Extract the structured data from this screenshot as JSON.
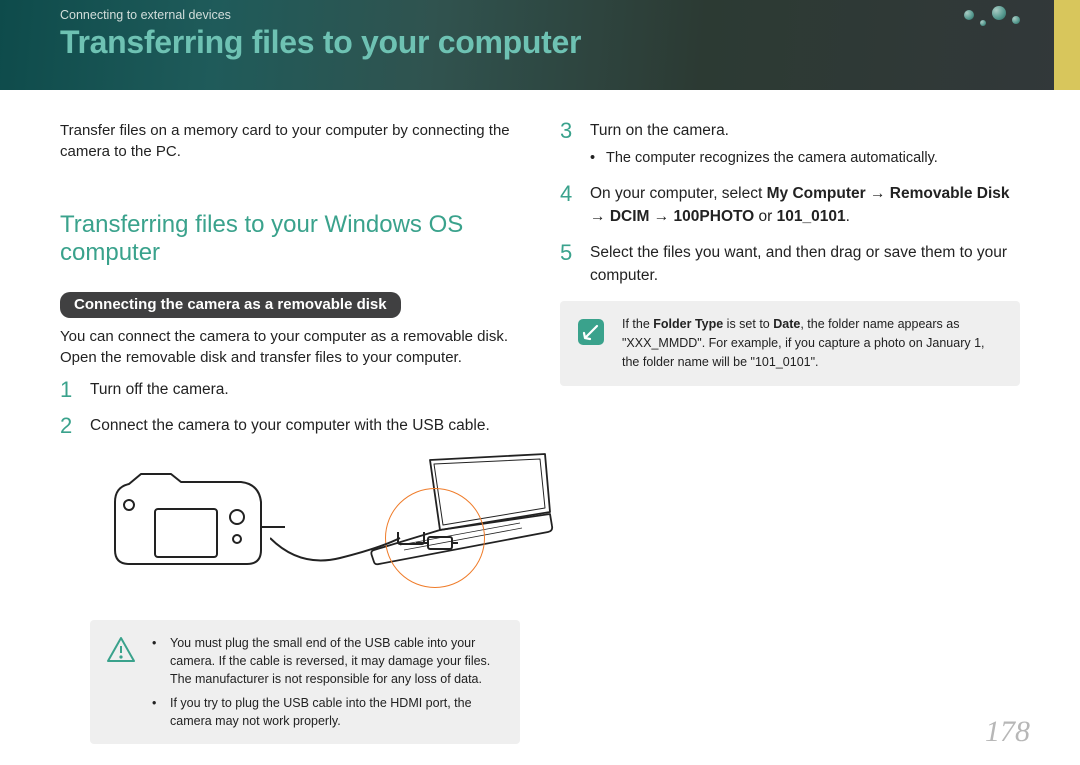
{
  "header": {
    "breadcrumb": "Connecting to external devices",
    "title": "Transferring files to your computer"
  },
  "left": {
    "intro": "Transfer files on a memory card to your computer by connecting the camera to the PC.",
    "section_title": "Transferring files to your Windows OS computer",
    "pill": "Connecting the camera as a removable disk",
    "pill_desc": "You can connect the camera to your computer as a removable disk. Open the removable disk and transfer files to your computer.",
    "step1_num": "1",
    "step1": "Turn off the camera.",
    "step2_num": "2",
    "step2": "Connect the camera to your computer with the USB cable.",
    "warn1": "You must plug the small end of the USB cable into your camera. If the cable is reversed, it may damage your files. The manufacturer is not responsible for any loss of data.",
    "warn2": "If you try to plug the USB cable into the HDMI port, the camera may not work properly."
  },
  "right": {
    "step3_num": "3",
    "step3": "Turn on the camera.",
    "step3_sub": "The computer recognizes the camera automatically.",
    "step4_num": "4",
    "step4_pre": "On your computer, select ",
    "step4_b1": "My Computer",
    "step4_arrow": " → ",
    "step4_b2": "Removable Disk",
    "step4_b3": "DCIM",
    "step4_b4": "100PHOTO",
    "step4_or": " or ",
    "step4_b5": "101_0101",
    "step4_end": ".",
    "step5_num": "5",
    "step5": "Select the files you want, and then drag or save them to your computer.",
    "note_pre": "If the ",
    "note_b1": "Folder Type",
    "note_mid1": " is set to ",
    "note_b2": "Date",
    "note_mid2": ", the folder name appears as \"XXX_MMDD\". For example, if you capture a photo on January 1, the folder name will be \"101_0101\"."
  },
  "page_number": "178"
}
